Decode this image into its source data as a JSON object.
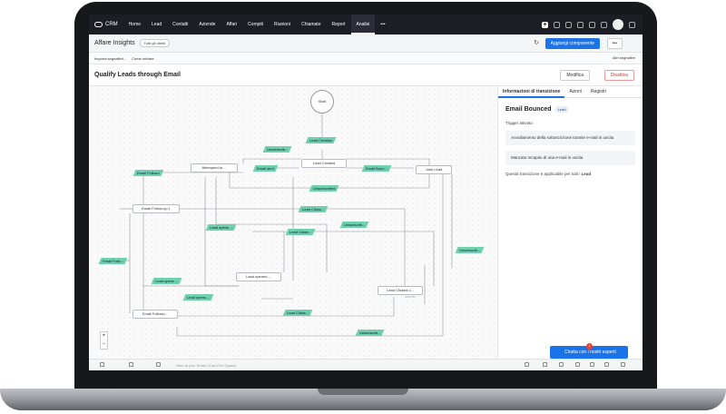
{
  "topbar": {
    "app": "CRM",
    "nav": [
      "Home",
      "Lead",
      "Contatti",
      "Aziende",
      "Affari",
      "Compiti",
      "Riunioni",
      "Chiamate",
      "Report",
      "Analisi",
      "•••"
    ]
  },
  "header": {
    "title": "Affare Insights",
    "tag": "Tutti gli utenti",
    "add_button": "Aggiungi componente",
    "more": "•••"
  },
  "subheader": {
    "import": "Importa segnalibri...",
    "start": "Come iniziare",
    "filters": "Altri segnalibri"
  },
  "page": {
    "title": "Qualify Leads through Email",
    "edit": "Modifica",
    "disable": "Disattiva"
  },
  "nodes": {
    "start": "Start",
    "lead_created": "Lead Created",
    "junk": "Junk Lead",
    "attempted": "Attempted to ...",
    "followup1": "Email Follow-up 1",
    "lead_opened": "Lead opened ...",
    "lead_clicked": "Lead Clicked o...",
    "followup2": "Email Followu..."
  },
  "transitions": {
    "lead_creation": "Lead Creation",
    "unsub1": "Unsubscrib...",
    "email_followl": "Email Follow-l",
    "email_sent": "Email sent",
    "email_boun": "Email Boun...",
    "unsubscribed": "Unsubscribed",
    "lead_clicks1": "Lead Clicks...",
    "lead_opens1": "Lead opens ...",
    "unsub2": "Unsubscrib...",
    "lead_clicke2": "Lead Clicke...",
    "unsub3": "Unsubscrib...",
    "email_follo": "Email Follo...",
    "lead_opens2": "Lead opens ...",
    "lead_opens3": "Lead opens ...",
    "lead_clicke3": "Lead Clicke...",
    "unsub4": "Unsubscrib..."
  },
  "side": {
    "tabs": [
      "Informazioni di transizione",
      "Azioni",
      "Registri"
    ],
    "title": "Email Bounced",
    "badge": "Lead",
    "trigger_label": "Trigger attivato",
    "cards": [
      "Annullamento della sottoscrizione tramite e-mail in uscita",
      "Mancato recapito di una e-mail in uscita"
    ],
    "note_prefix": "Questa transizione è applicabile per tutti i",
    "note_bold": "Lead"
  },
  "chat": {
    "label": "Chatta con i nostri esperti",
    "badge": "1"
  },
  "footer": {
    "smart_chat": "Here is your Smart Chat (Ctrl+Space)"
  }
}
